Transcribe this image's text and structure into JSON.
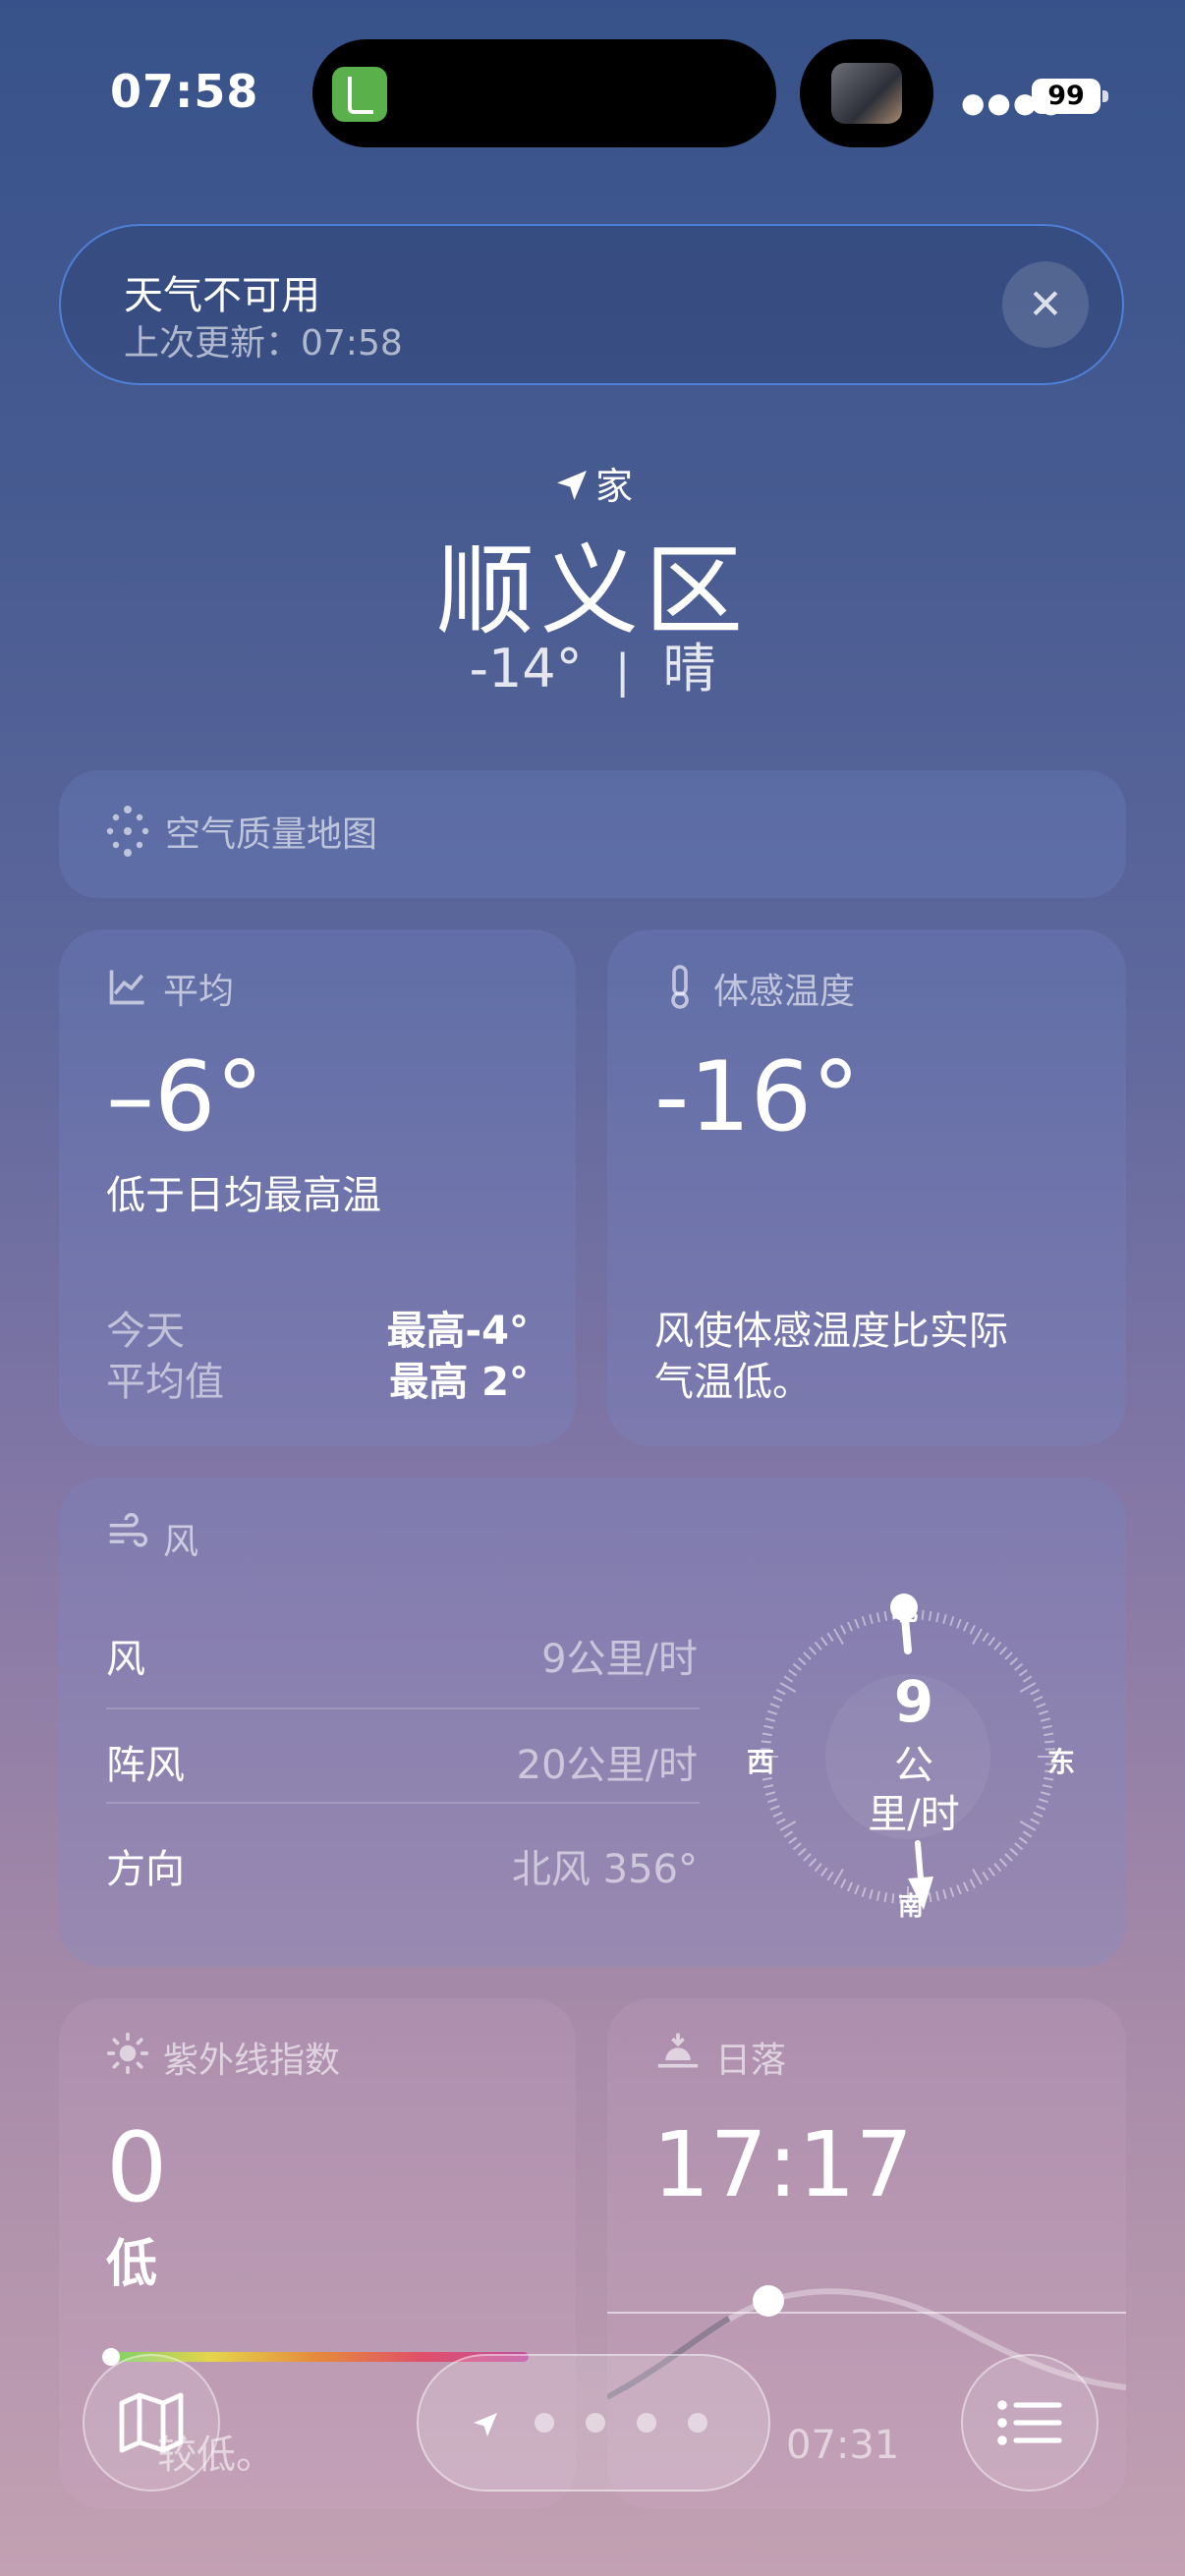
{
  "status_bar": {
    "time": "07:58",
    "battery": "99"
  },
  "banner": {
    "title": "天气不可用",
    "subtitle": "上次更新：07:58",
    "close_symbol": "✕"
  },
  "location": {
    "label": "家",
    "city": "顺义区",
    "temperature": "-14°",
    "separator": "|",
    "condition": "晴"
  },
  "air_quality": {
    "label": "空气质量地图"
  },
  "average": {
    "label": "平均",
    "value": "–6°",
    "description": "低于日均最高温",
    "today_label": "今天",
    "today_value": "最高-4°",
    "avg_label": "平均值",
    "avg_value": "最高 2°"
  },
  "feels_like": {
    "label": "体感温度",
    "value": "-16°",
    "description_line1": "风使体感温度比实际",
    "description_line2": "气温低。"
  },
  "wind": {
    "label": "风",
    "rows": [
      {
        "label": "风",
        "value": "9公里/时"
      },
      {
        "label": "阵风",
        "value": "20公里/时"
      },
      {
        "label": "方向",
        "value": "北风 356°"
      }
    ],
    "compass": {
      "speed": "9",
      "unit_line1": "公",
      "unit_line2": "里/时",
      "north": "北",
      "south": "南",
      "east": "东",
      "west": "西"
    }
  },
  "uv": {
    "label": "紫外线指数",
    "value": "0",
    "level": "低",
    "note": "较低。"
  },
  "sunset": {
    "label": "日落",
    "time": "17:17",
    "sunrise_time": "07:31"
  },
  "colors": {
    "banner_border": "#4f7fd6",
    "uv_bar_start": "#7bd06a",
    "uv_bar_end": "#c04fa0"
  }
}
